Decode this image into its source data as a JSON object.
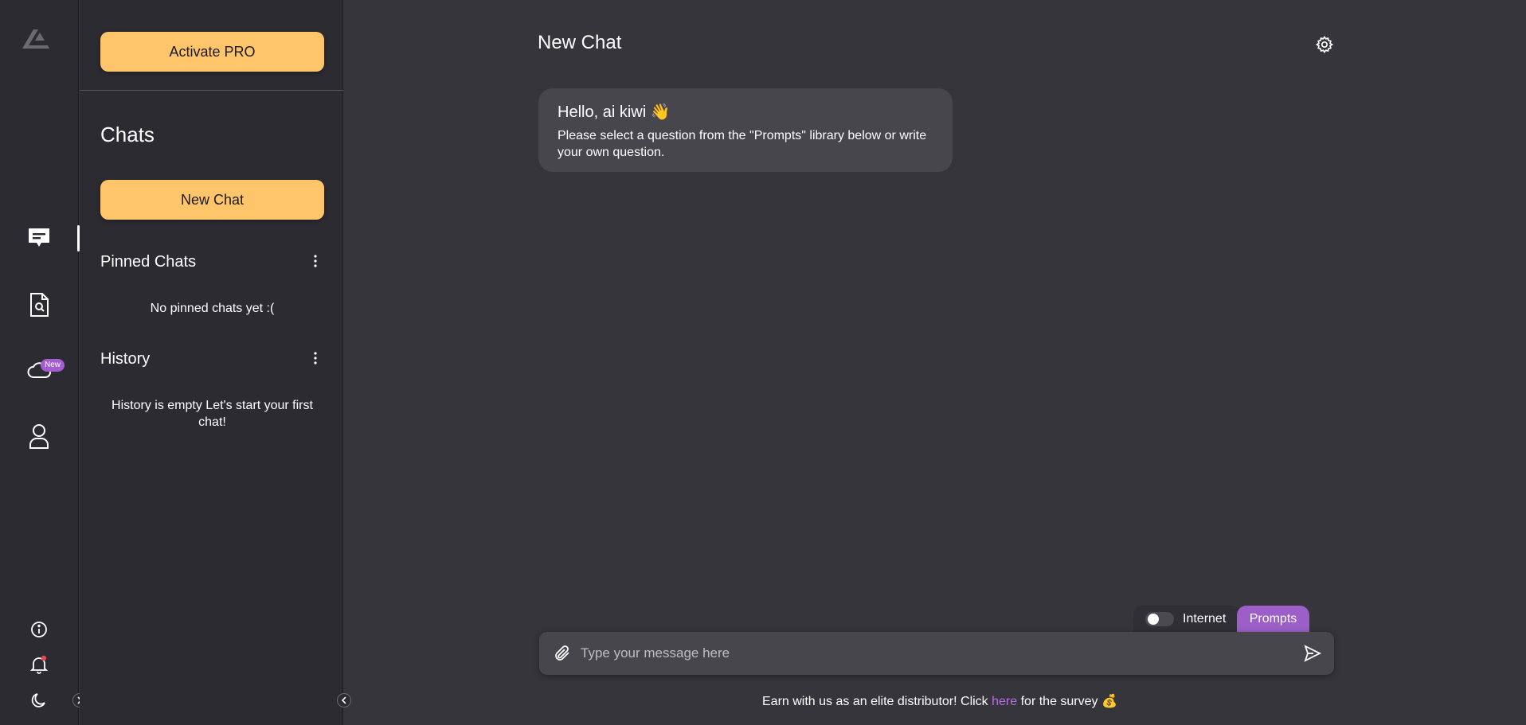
{
  "sidebar": {
    "activate_label": "Activate PRO",
    "chats_title": "Chats",
    "new_chat_label": "New Chat",
    "pinned": {
      "title": "Pinned Chats",
      "empty_text": "No pinned chats yet :("
    },
    "history": {
      "title": "History",
      "empty_text": "History is empty Let's start your first chat!"
    }
  },
  "rail": {
    "new_badge": "New",
    "icons": [
      "logo-icon",
      "chat-icon",
      "document-search-icon",
      "cloud-icon",
      "user-icon",
      "info-icon",
      "bell-icon",
      "moon-icon"
    ]
  },
  "main": {
    "title": "New Chat",
    "greeting": "Hello, ai kiwi 👋",
    "message": "Please select a question from the \"Prompts\" library below or write your own question.",
    "internet_label": "Internet",
    "prompts_label": "Prompts",
    "input_placeholder": "Type your message here",
    "footer": {
      "before": "Earn with us as an elite distributor! Click ",
      "link": "here",
      "after": " for the survey 💰"
    }
  },
  "colors": {
    "accent_yellow": "#ffc56b",
    "accent_purple": "#9b5fc7",
    "rail_bg": "#2b2b31",
    "main_bg": "#36353b"
  }
}
